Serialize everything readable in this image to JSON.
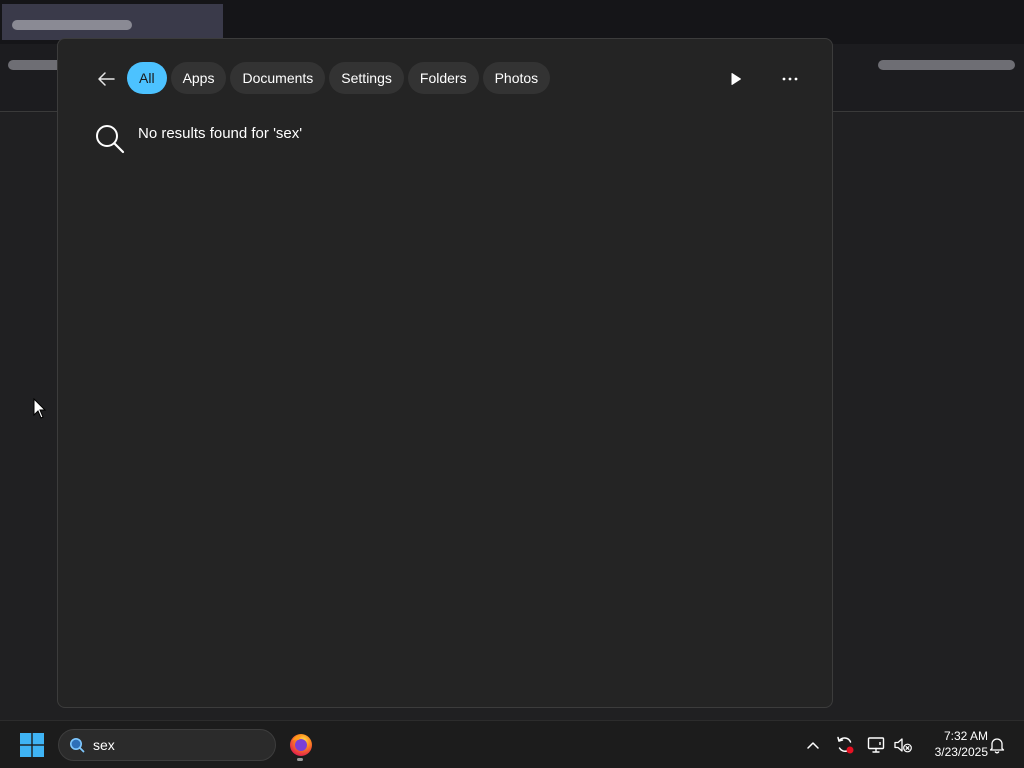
{
  "flyout": {
    "filters": [
      {
        "label": "All",
        "active": true
      },
      {
        "label": "Apps",
        "active": false
      },
      {
        "label": "Documents",
        "active": false
      },
      {
        "label": "Settings",
        "active": false
      },
      {
        "label": "Folders",
        "active": false
      },
      {
        "label": "Photos",
        "active": false
      }
    ],
    "no_results_text": "No results found for 'sex'",
    "icons": {
      "back": "back-arrow-icon",
      "play": "play-icon",
      "more": "more-options-icon",
      "search": "search-icon"
    }
  },
  "taskbar": {
    "search_value": "sex",
    "clock": {
      "time": "7:32 AM",
      "date": "3/23/2025"
    },
    "icons": {
      "start": "windows-start-icon",
      "firefox": "firefox-icon",
      "tray_overflow": "chevron-up-icon",
      "sync": "sync-icon",
      "network": "network-icon",
      "volume": "volume-muted-icon",
      "notifications": "bell-icon"
    }
  },
  "colors": {
    "accent": "#4cc2ff",
    "flyout_bg": "#242424",
    "taskbar_bg": "#1c1c1c"
  }
}
